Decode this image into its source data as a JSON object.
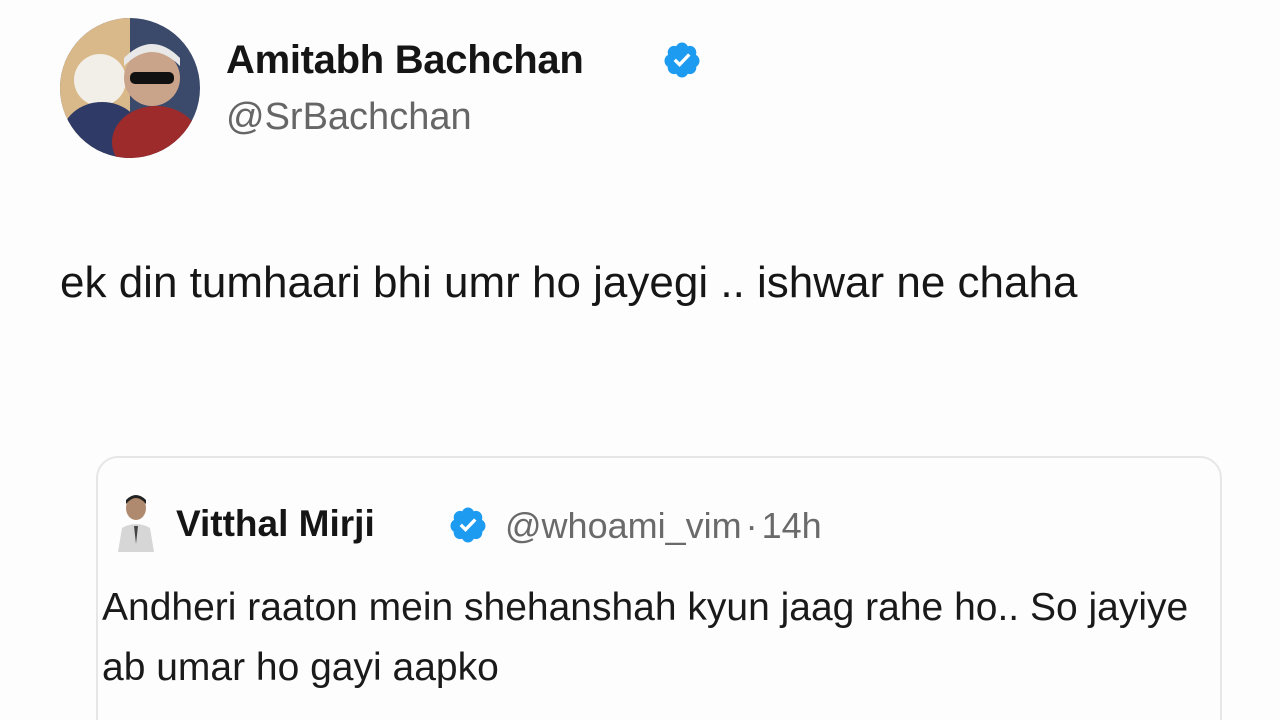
{
  "tweet": {
    "author": {
      "display_name": "Amitabh Bachchan",
      "handle": "@SrBachchan",
      "verified": true
    },
    "text": "ek din tumhaari bhi umr ho jayegi .. ishwar ne chaha"
  },
  "quoted_tweet": {
    "author": {
      "display_name": "Vitthal Mirji",
      "handle": "@whoami_vim",
      "verified": true
    },
    "separator": "·",
    "time": "14h",
    "text": "Andheri raaton mein shehanshah kyun jaag rahe ho.. So jayiye ab umar ho gayi aapko"
  },
  "icons": {
    "verified": "verified-badge-icon"
  },
  "colors": {
    "verified_blue": "#1d9bf0",
    "handle_gray": "#666666",
    "text": "#161616"
  }
}
